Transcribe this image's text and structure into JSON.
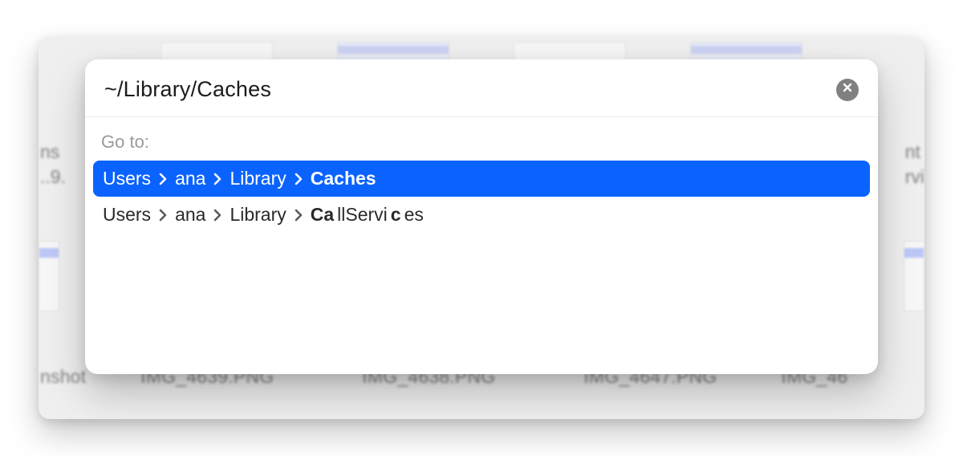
{
  "dialog": {
    "input_value": "~/Library/Caches",
    "section_label": "Go to:",
    "close_label": "Close"
  },
  "results": [
    {
      "selected": true,
      "segments": [
        {
          "text": "Users",
          "weight": "normal"
        },
        {
          "text": "ana",
          "weight": "normal"
        },
        {
          "text": "Library",
          "weight": "normal"
        },
        {
          "text": "Caches",
          "weight": "bold"
        }
      ]
    },
    {
      "selected": false,
      "segments": [
        {
          "text": "Users",
          "weight": "normal"
        },
        {
          "text": "ana",
          "weight": "normal"
        },
        {
          "text": "Library",
          "weight": "normal"
        },
        {
          "text_parts": [
            {
              "t": "Ca",
              "w": "bold"
            },
            {
              "t": "llServi",
              "w": "normal"
            },
            {
              "t": "c",
              "w": "bold"
            },
            {
              "t": "es",
              "w": "normal"
            }
          ]
        }
      ]
    }
  ],
  "background": {
    "left_fragments": [
      "ns",
      "..9."
    ],
    "right_fragments": [
      "nt",
      "rvi"
    ],
    "bottom_labels": [
      "nshot",
      "IMG_4639.PNG",
      "IMG_4638.PNG",
      "IMG_4647.PNG",
      "IMG_46"
    ]
  }
}
